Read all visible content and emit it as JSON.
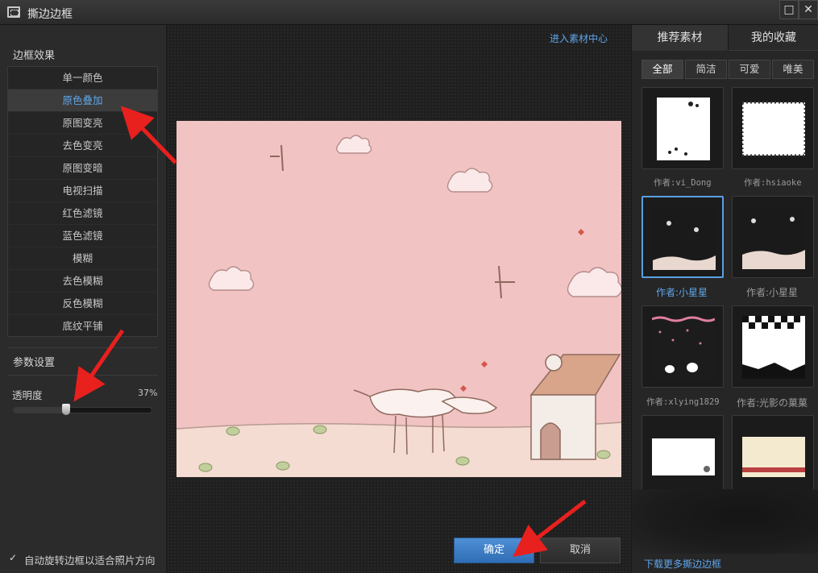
{
  "window": {
    "title": "撕边边框",
    "maximize_icon": "□",
    "close_icon": "✕"
  },
  "left": {
    "effects_title": "边框效果",
    "effects": [
      "单一颜色",
      "原色叠加",
      "原图变亮",
      "去色变亮",
      "原图变暗",
      "电视扫描",
      "红色滤镜",
      "蓝色滤镜",
      "模糊",
      "去色模糊",
      "反色模糊",
      "底纹平铺"
    ],
    "selected_effect_index": 1,
    "params_title": "参数设置",
    "opacity_label": "透明度",
    "opacity_value": "37%",
    "opacity_fraction": 0.37,
    "auto_rotate_label": "自动旋转边框以适合照片方向",
    "auto_rotate_checked": true,
    "check_glyph": "✓"
  },
  "center": {
    "material_center_link": "进入素材中心",
    "ok_label": "确定",
    "cancel_label": "取消"
  },
  "right": {
    "tabs": [
      "推荐素材",
      "我的收藏"
    ],
    "filters": [
      "全部",
      "简洁",
      "可爱",
      "唯美"
    ],
    "thumbnails": [
      {
        "author": "作者:vi_Dong"
      },
      {
        "author": "作者:hsiaoke"
      },
      {
        "author": "作者:小星星"
      },
      {
        "author": "作者:小星星"
      },
      {
        "author": "作者:xlying1829"
      },
      {
        "author": "作者:光影の菓菓"
      },
      {
        "author": ""
      },
      {
        "author": ""
      }
    ],
    "download_more": "下载更多撕边边框"
  },
  "colors": {
    "accent": "#5fa6e8",
    "annotation": "#e8201e",
    "preview_bg": "#f1c3c3"
  }
}
